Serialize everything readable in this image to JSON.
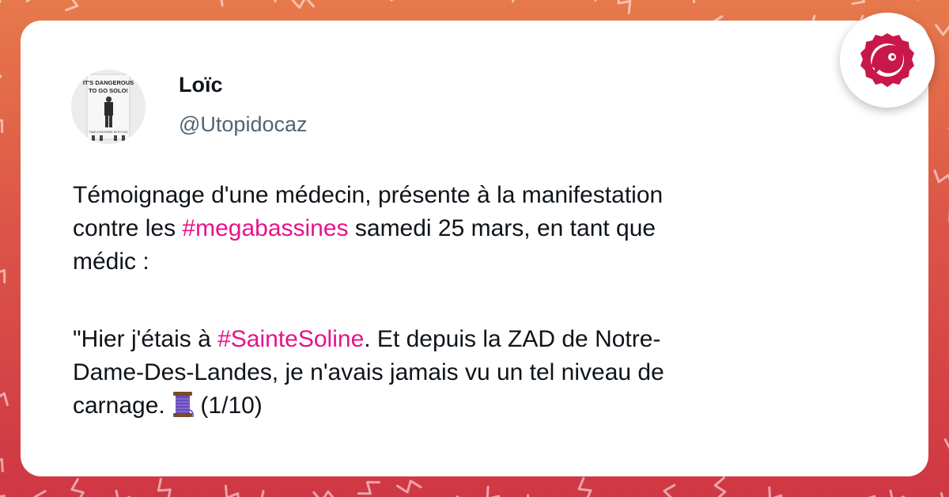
{
  "tweet": {
    "author_name": "Loïc",
    "author_handle": "@Utopidocaz",
    "paragraph1": {
      "line1": "Témoignage d'une médecin, présente à la manifestation",
      "line2_before": "contre les ",
      "line2_hashtag": "#megabassines",
      "line2_after": " samedi 25 mars, en tant que",
      "line3": "médic :"
    },
    "paragraph2": {
      "line1_before": "\"Hier j'étais à ",
      "line1_hashtag": "#SainteSoline",
      "line1_after": ". Et depuis la ZAD de Notre-",
      "line2": "Dame-Des-Landes, je n'avais jamais vu un tel niveau de",
      "line3_before": "carnage. ",
      "line3_after": " (1/10)"
    },
    "emoji_name": "spool-of-thread-icon"
  },
  "avatar_poster": {
    "top_text_1": "IT'S DANGEROUS",
    "top_text_2": "TO GO SOLO!",
    "bottom_text": "TAKE A WOOKIEE WITH YOU"
  },
  "colors": {
    "hashtag": "#e6138a",
    "text": "#0f1419",
    "handle": "#536471",
    "brand": "#c8174a",
    "background_top": "#e7794b",
    "background_bottom": "#cf3744"
  },
  "brand_icon": "brand-logo-icon"
}
